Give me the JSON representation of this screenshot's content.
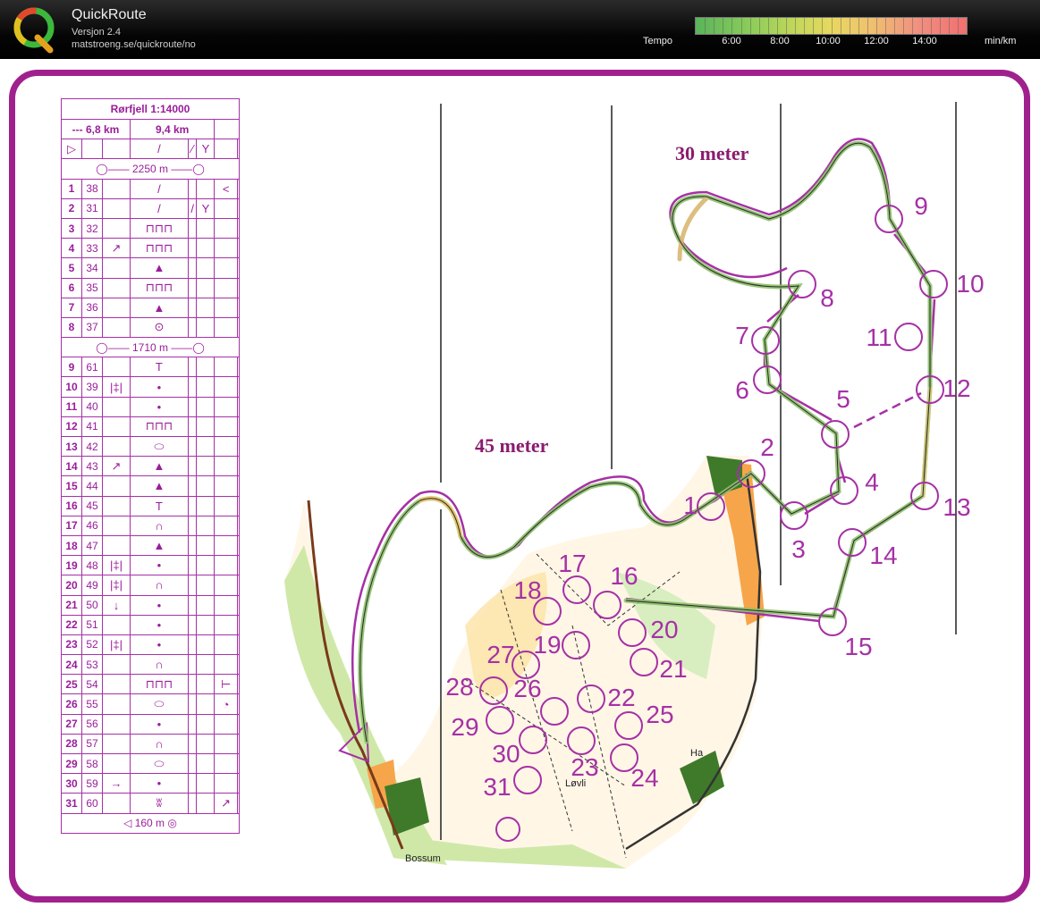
{
  "header": {
    "app_name": "QuickRoute",
    "version": "Versjon 2.4",
    "url": "matstroeng.se/quickroute/no",
    "pace_label": "Tempo",
    "pace_unit": "min/km",
    "pace_ticks": [
      "6:00",
      "8:00",
      "10:00",
      "12:00",
      "14:00"
    ],
    "colors": {
      "slow": "#f07070",
      "fast": "#5ab35a",
      "course": "#a0218e"
    }
  },
  "map": {
    "labels": {
      "climb_30": "30 meter",
      "climb_45": "45 meter",
      "place_bossum": "Bossum",
      "place_lovli": "Løvli",
      "place_ha": "Ha"
    },
    "controls": [
      "1",
      "2",
      "3",
      "4",
      "5",
      "6",
      "7",
      "8",
      "9",
      "10",
      "11",
      "12",
      "13",
      "14",
      "15",
      "16",
      "17",
      "18",
      "19",
      "20",
      "21",
      "22",
      "23",
      "24",
      "25",
      "26",
      "27",
      "28",
      "29",
      "30",
      "31"
    ]
  },
  "description": {
    "title": "Rørfjell 1:14000",
    "length_left": "--- 6,8 km",
    "length_right": "9,4 km",
    "leg1": "2250 m",
    "leg2": "1710 m",
    "leg3": "160 m",
    "rows": [
      {
        "n": "1",
        "c": "38",
        "d": "",
        "f": "/",
        "e": "",
        "g": "",
        "x": "<"
      },
      {
        "n": "2",
        "c": "31",
        "d": "",
        "f": "/",
        "e": "/",
        "g": "Y",
        "x": ""
      },
      {
        "n": "3",
        "c": "32",
        "d": "",
        "f": "⊓⊓⊓",
        "e": "",
        "g": "",
        "x": ""
      },
      {
        "n": "4",
        "c": "33",
        "d": "↗",
        "f": "⊓⊓⊓",
        "e": "",
        "g": "",
        "x": ""
      },
      {
        "n": "5",
        "c": "34",
        "d": "",
        "f": "▲",
        "e": "",
        "g": "",
        "x": ""
      },
      {
        "n": "6",
        "c": "35",
        "d": "",
        "f": "⊓⊓⊓",
        "e": "",
        "g": "",
        "x": ""
      },
      {
        "n": "7",
        "c": "36",
        "d": "",
        "f": "▲",
        "e": "",
        "g": "",
        "x": ""
      },
      {
        "n": "8",
        "c": "37",
        "d": "",
        "f": "⊙",
        "e": "",
        "g": "",
        "x": ""
      },
      {
        "n": "9",
        "c": "61",
        "d": "",
        "f": "T",
        "e": "",
        "g": "",
        "x": ""
      },
      {
        "n": "10",
        "c": "39",
        "d": "|‡|",
        "f": "•",
        "e": "",
        "g": "",
        "x": ""
      },
      {
        "n": "11",
        "c": "40",
        "d": "",
        "f": "•",
        "e": "",
        "g": "",
        "x": ""
      },
      {
        "n": "12",
        "c": "41",
        "d": "",
        "f": "⊓⊓⊓",
        "e": "",
        "g": "",
        "x": ""
      },
      {
        "n": "13",
        "c": "42",
        "d": "",
        "f": "⬭",
        "e": "",
        "g": "",
        "x": ""
      },
      {
        "n": "14",
        "c": "43",
        "d": "↗",
        "f": "▲",
        "e": "",
        "g": "",
        "x": ""
      },
      {
        "n": "15",
        "c": "44",
        "d": "",
        "f": "▲",
        "e": "",
        "g": "",
        "x": ""
      },
      {
        "n": "16",
        "c": "45",
        "d": "",
        "f": "T",
        "e": "",
        "g": "",
        "x": ""
      },
      {
        "n": "17",
        "c": "46",
        "d": "",
        "f": "∩",
        "e": "",
        "g": "",
        "x": ""
      },
      {
        "n": "18",
        "c": "47",
        "d": "",
        "f": "▲",
        "e": "",
        "g": "",
        "x": ""
      },
      {
        "n": "19",
        "c": "48",
        "d": "|‡|",
        "f": "•",
        "e": "",
        "g": "",
        "x": ""
      },
      {
        "n": "20",
        "c": "49",
        "d": "|‡|",
        "f": "∩",
        "e": "",
        "g": "",
        "x": ""
      },
      {
        "n": "21",
        "c": "50",
        "d": "↓",
        "f": "•",
        "e": "",
        "g": "",
        "x": ""
      },
      {
        "n": "22",
        "c": "51",
        "d": "",
        "f": "•",
        "e": "",
        "g": "",
        "x": ""
      },
      {
        "n": "23",
        "c": "52",
        "d": "|‡|",
        "f": "•",
        "e": "",
        "g": "",
        "x": ""
      },
      {
        "n": "24",
        "c": "53",
        "d": "",
        "f": "∩",
        "e": "",
        "g": "",
        "x": ""
      },
      {
        "n": "25",
        "c": "54",
        "d": "",
        "f": "⊓⊓⊓",
        "e": "",
        "g": "",
        "x": "⊢"
      },
      {
        "n": "26",
        "c": "55",
        "d": "",
        "f": "⬭",
        "e": "",
        "g": "",
        "x": "◔"
      },
      {
        "n": "27",
        "c": "56",
        "d": "",
        "f": "•",
        "e": "",
        "g": "",
        "x": ""
      },
      {
        "n": "28",
        "c": "57",
        "d": "",
        "f": "∩",
        "e": "",
        "g": "",
        "x": ""
      },
      {
        "n": "29",
        "c": "58",
        "d": "",
        "f": "⬭",
        "e": "",
        "g": "",
        "x": ""
      },
      {
        "n": "30",
        "c": "59",
        "d": "→",
        "f": "•",
        "e": "",
        "g": "",
        "x": ""
      },
      {
        "n": "31",
        "c": "60",
        "d": "",
        "f": "ʬ",
        "e": "",
        "g": "",
        "x": "↗"
      }
    ]
  }
}
